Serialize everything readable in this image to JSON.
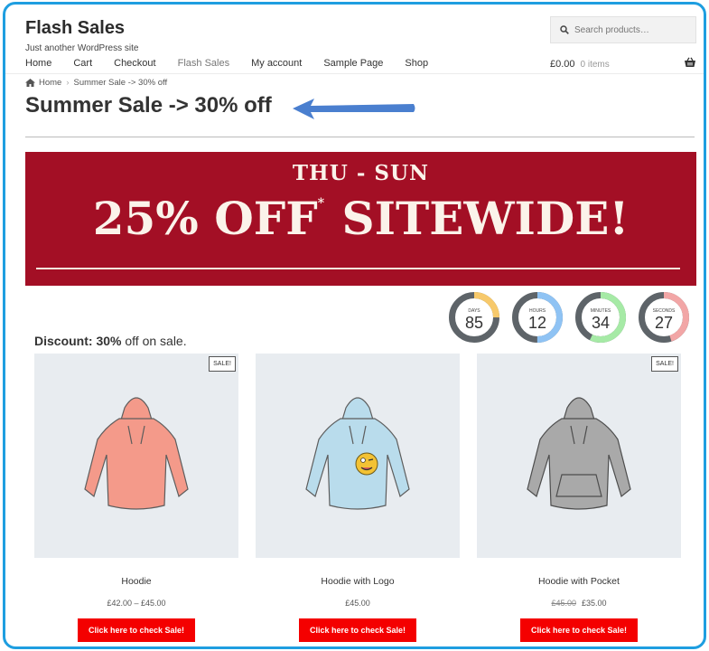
{
  "site": {
    "title": "Flash Sales",
    "tagline": "Just another WordPress site"
  },
  "search": {
    "placeholder": "Search products…"
  },
  "nav": {
    "items": [
      "Home",
      "Cart",
      "Checkout",
      "Flash Sales",
      "My account",
      "Sample Page",
      "Shop"
    ]
  },
  "cart": {
    "total": "£0.00",
    "count": "0 items"
  },
  "breadcrumb": {
    "home": "Home",
    "current": "Summer Sale -> 30% off"
  },
  "page": {
    "title": "Summer Sale -> 30% off"
  },
  "banner": {
    "line1": "THU - SUN",
    "line2_a": "25% OFF",
    "asterisk": "*",
    "line2_b": "SITEWIDE!"
  },
  "countdown": [
    {
      "label": "DAYS",
      "value": "85",
      "color": "#f7c96b",
      "fraction": 0.25
    },
    {
      "label": "HOURS",
      "value": "12",
      "color": "#8fc3f4",
      "fraction": 0.5
    },
    {
      "label": "MINUTES",
      "value": "34",
      "color": "#a6eaa6",
      "fraction": 0.57
    },
    {
      "label": "SECONDS",
      "value": "27",
      "color": "#f2a6a6",
      "fraction": 0.45
    }
  ],
  "discount": {
    "label": "Discount:",
    "value": "30%",
    "suffix": "off on sale."
  },
  "products": [
    {
      "name": "Hoodie",
      "price": "£42.00 – £45.00",
      "old_price": "",
      "sale_badge": "SALE!",
      "button": "Click here to check Sale!",
      "color": "#f49a8a"
    },
    {
      "name": "Hoodie with Logo",
      "price": "£45.00",
      "old_price": "",
      "sale_badge": "",
      "button": "Click here to check Sale!",
      "color": "#b9dcec"
    },
    {
      "name": "Hoodie with Pocket",
      "price": "£35.00",
      "old_price": "£45.00",
      "sale_badge": "SALE!",
      "button": "Click here to check Sale!",
      "color": "#a9a9a9"
    }
  ],
  "colors": {
    "accent": "#1e9ee0",
    "banner": "#a30f25",
    "button": "#f40000",
    "arrow": "#4a7fcf"
  }
}
